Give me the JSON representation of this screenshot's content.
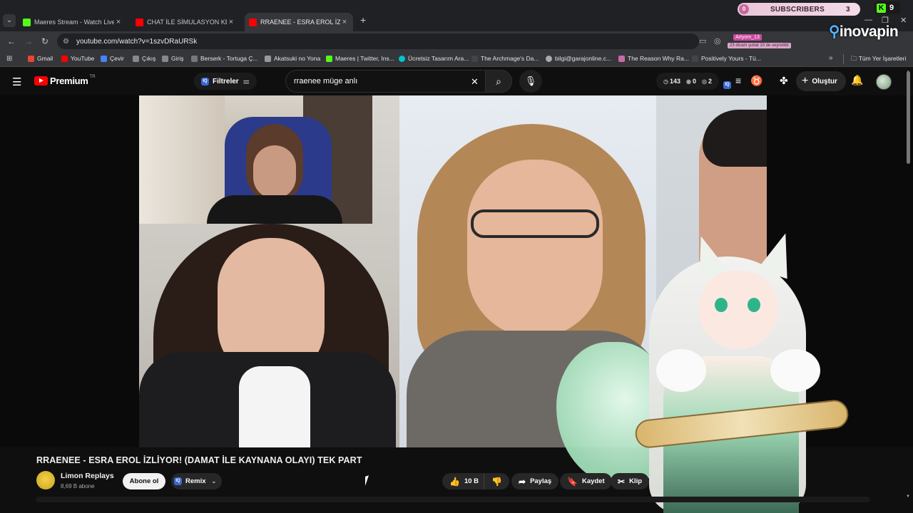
{
  "browser": {
    "tabs": [
      {
        "title": "Maeres Stream - Watch Live on",
        "color": "#53fc18"
      },
      {
        "title": "CHAT İLE SİMULASYON KEYFİ |",
        "color": "#ff0000"
      },
      {
        "title": "RRAENEE - ESRA EROL İZLİYOR",
        "color": "#ff0000"
      }
    ],
    "url": "youtube.com/watch?v=1szvDRaURSk",
    "bookmarks": [
      "Gmail",
      "YouTube",
      "Çevir",
      "Çıkış",
      "Giriş",
      "Berserk - Tortuga Ç...",
      "Akatsuki no Yona",
      "Maeres | Twitter, Ins...",
      "Ücretsiz Tasarım Ara...",
      "The Archmage's Da...",
      "bilgi@garajonline.c...",
      "The Reason Why Ra...",
      "Positively Yours - Tü..."
    ],
    "all_bookmarks": "Tüm Yer İşaretleri"
  },
  "overlay": {
    "subscribers_label": "SUBSCRIBERS",
    "subscribers_left": "0",
    "subscribers_count": "3",
    "kick_count": "9",
    "ext_user": "Artyom_13",
    "ext_note": "23 dicam şubat 10 de seyretildi",
    "brand": "inovapin"
  },
  "youtube": {
    "logo": "Premium",
    "region": "TR",
    "filter_label": "Filtreler",
    "search_value": "rraenee müge anlı",
    "stats": {
      "views": "143",
      "eye": "0",
      "eye2": "2"
    },
    "create_label": "Oluştur"
  },
  "video": {
    "title": "RRAENEE - ESRA EROL İZLİYOR! (DAMAT İLE KAYNANA OLAYI) TEK PART",
    "channel": "Limon Replays",
    "subscribers": "8,69 B abone",
    "subscribe_label": "Abone ol",
    "remix_label": "Remix",
    "likes": "10 B",
    "share_label": "Paylaş",
    "save_label": "Kaydet",
    "clip_label": "Klip"
  }
}
